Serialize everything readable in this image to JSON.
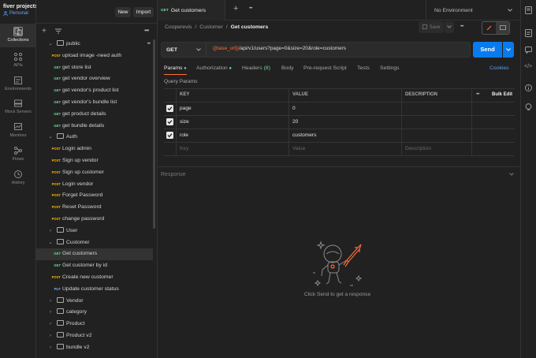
{
  "workspace": {
    "name": "fiver projects",
    "type": "Personal",
    "new_label": "New",
    "import_label": "Import"
  },
  "rail": [
    {
      "label": "Collections",
      "icon": "collections-icon"
    },
    {
      "label": "APIs",
      "icon": "apis-icon"
    },
    {
      "label": "Environments",
      "icon": "environments-icon"
    },
    {
      "label": "Mock Servers",
      "icon": "mock-servers-icon"
    },
    {
      "label": "Monitors",
      "icon": "monitors-icon"
    },
    {
      "label": "Flows",
      "icon": "flows-icon"
    },
    {
      "label": "History",
      "icon": "history-icon"
    }
  ],
  "tree": [
    {
      "kind": "folder",
      "label": "public",
      "open": true
    },
    {
      "kind": "request",
      "method": "POST",
      "label": "upload image -need auth"
    },
    {
      "kind": "request",
      "method": "GET",
      "label": "get store list"
    },
    {
      "kind": "request",
      "method": "GET",
      "label": "get vendor overview"
    },
    {
      "kind": "request",
      "method": "GET",
      "label": "get vendor's product list"
    },
    {
      "kind": "request",
      "method": "GET",
      "label": "get vendor's bundle list"
    },
    {
      "kind": "request",
      "method": "GET",
      "label": "get product details"
    },
    {
      "kind": "request",
      "method": "GET",
      "label": "get bundle details"
    },
    {
      "kind": "folder",
      "label": "Auth",
      "open": true
    },
    {
      "kind": "request",
      "method": "POST",
      "label": "Login admin"
    },
    {
      "kind": "request",
      "method": "POST",
      "label": "Sign up vendor"
    },
    {
      "kind": "request",
      "method": "POST",
      "label": "Sign up customer"
    },
    {
      "kind": "request",
      "method": "POST",
      "label": "Login vendor"
    },
    {
      "kind": "request",
      "method": "POST",
      "label": "Forget Password"
    },
    {
      "kind": "request",
      "method": "POST",
      "label": "Reset Password"
    },
    {
      "kind": "request",
      "method": "POST",
      "label": "change password"
    },
    {
      "kind": "folder",
      "label": "User",
      "open": false
    },
    {
      "kind": "folder",
      "label": "Customer",
      "open": true
    },
    {
      "kind": "request",
      "method": "GET",
      "label": "Get customers",
      "selected": true
    },
    {
      "kind": "request",
      "method": "GET",
      "label": "Get customer by id"
    },
    {
      "kind": "request",
      "method": "POST",
      "label": "Create new customer"
    },
    {
      "kind": "request",
      "method": "PUT",
      "label": "Update customer status"
    },
    {
      "kind": "folder",
      "label": "Vendor",
      "open": false
    },
    {
      "kind": "folder",
      "label": "category",
      "open": false
    },
    {
      "kind": "folder",
      "label": "Product",
      "open": false
    },
    {
      "kind": "folder",
      "label": "Product v2",
      "open": false
    },
    {
      "kind": "folder",
      "label": "bundle v2",
      "open": false
    }
  ],
  "tab": {
    "method": "GET",
    "title": "Get customers"
  },
  "env": {
    "label": "No Environment"
  },
  "breadcrumb": {
    "part1": "Cooperevis",
    "sep": "/",
    "part2": "Customer",
    "part3": "Get customers"
  },
  "save_label": "Save",
  "request": {
    "method": "GET",
    "url_var": "{{base_url}}",
    "url_rest": "/api/v1/users?page=0&size=20&role=customers",
    "send_label": "Send"
  },
  "req_tabs": {
    "params": "Params",
    "authorization": "Authorization",
    "headers": "Headers",
    "headers_count": "(8)",
    "body": "Body",
    "prerequest": "Pre-request Script",
    "tests": "Tests",
    "settings": "Settings",
    "cookies": "Cookies"
  },
  "query_params_label": "Query Params",
  "params_table": {
    "headers": {
      "key": "KEY",
      "value": "VALUE",
      "description": "DESCRIPTION",
      "bulk": "Bulk Edit"
    },
    "rows": [
      {
        "key": "page",
        "value": "0",
        "checked": true
      },
      {
        "key": "size",
        "value": "20",
        "checked": true
      },
      {
        "key": "role",
        "value": "customers",
        "checked": true
      }
    ],
    "placeholder": {
      "key": "Key",
      "value": "Value",
      "description": "Description"
    }
  },
  "response": {
    "label": "Response",
    "empty_text": "Click Send to get a response"
  },
  "colors": {
    "accent": "#ff6c37",
    "send": "#097bed",
    "get": "#6bdd9a",
    "post": "#ffb400",
    "put": "#74aef6"
  }
}
